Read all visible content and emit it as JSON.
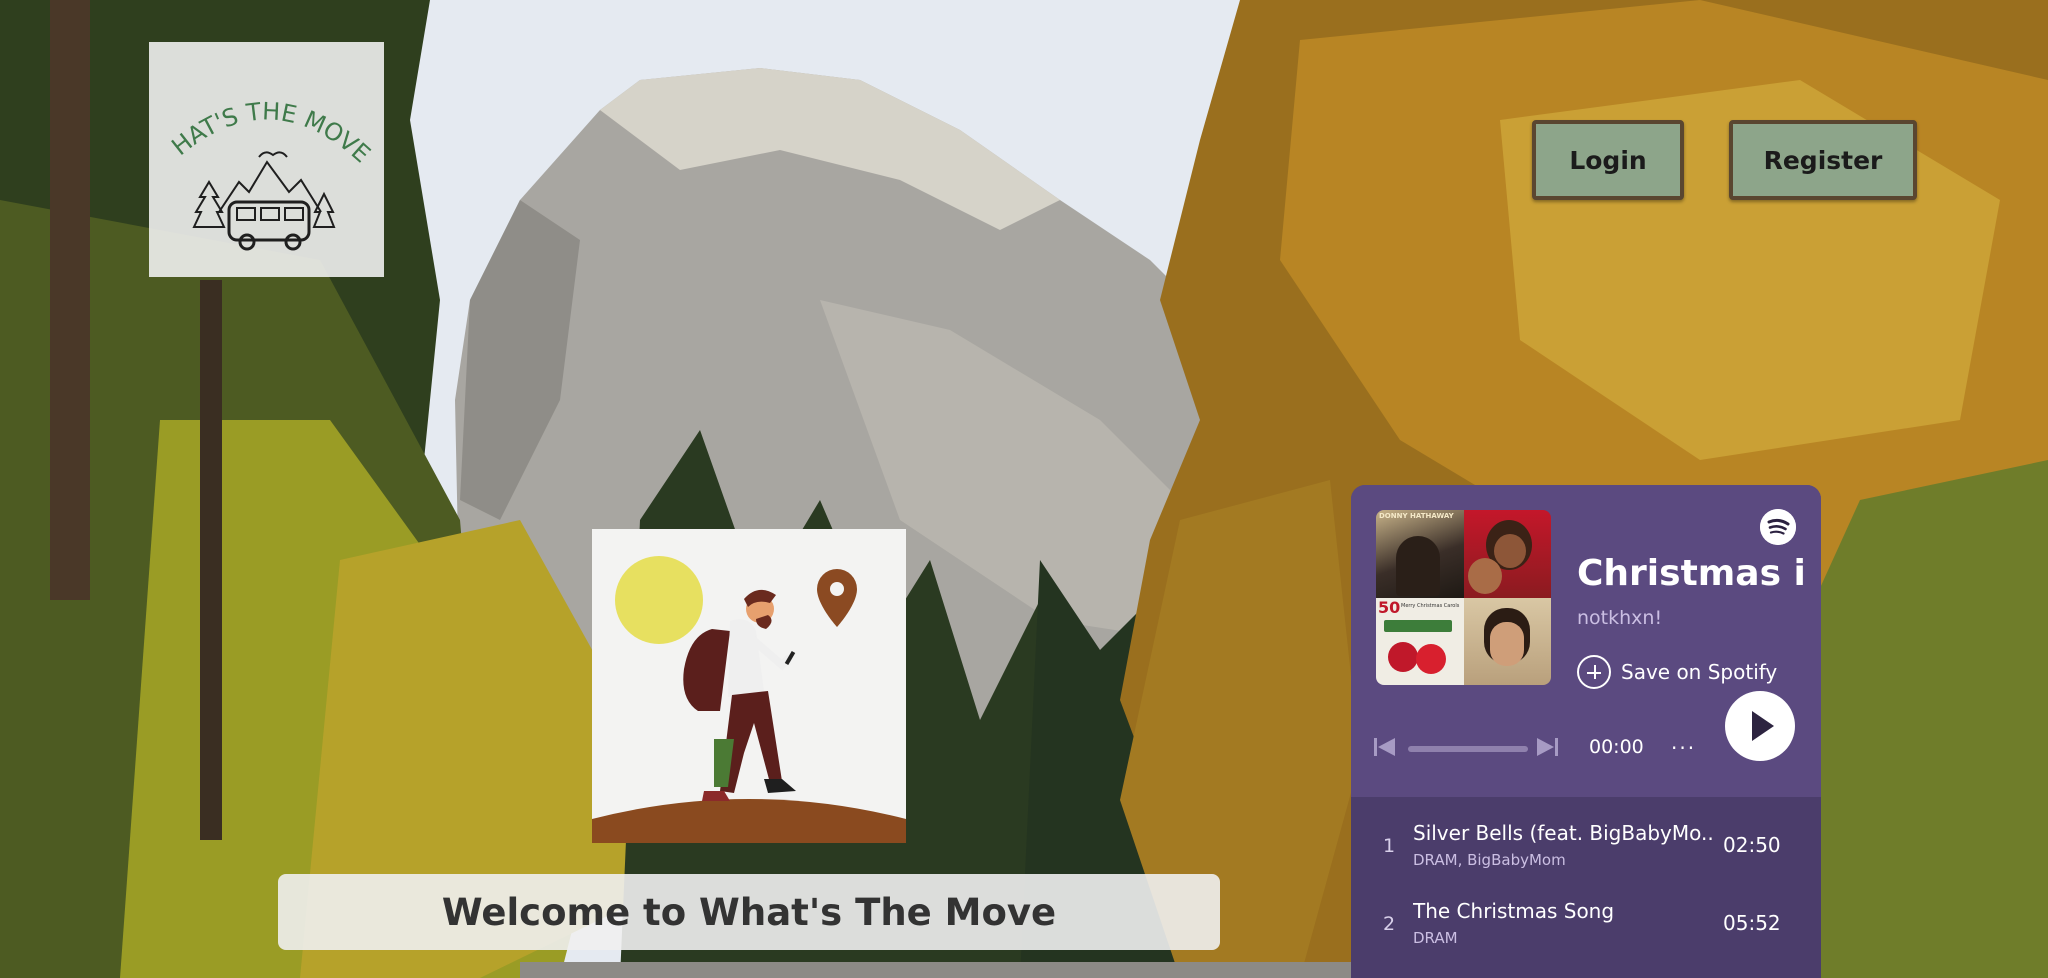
{
  "app": {
    "logo_text": "WHAT'S THE MOVE?"
  },
  "header": {
    "login_label": "Login",
    "register_label": "Register"
  },
  "hero": {
    "welcome": "Welcome to What's The Move"
  },
  "spotify": {
    "playlist_title": "Christmas ig",
    "owner": "notkhxn!",
    "save_label": "Save on Spotify",
    "time": "00:00",
    "more": "···",
    "progress_fraction": 0,
    "cover_texts": [
      "DONNY HATHAWAY",
      "50",
      "Merry Christmas Carols"
    ],
    "tracks": [
      {
        "index": "1",
        "title": "Silver Bells (feat. BigBabyMo...",
        "artist": "DRAM, BigBabyMom",
        "duration": "02:50"
      },
      {
        "index": "2",
        "title": "The Christmas Song",
        "artist": "DRAM",
        "duration": "05:52"
      }
    ]
  },
  "colors": {
    "button_bg": "#8da58a",
    "button_border": "#5a4630",
    "widget_bg": "#5b4a80",
    "widget_list_bg": "#4b3d6b",
    "sun": "#e7e060",
    "pin": "#8b4a22"
  },
  "icons": [
    "spotify-icon",
    "plus-circle-icon",
    "skip-previous-icon",
    "skip-next-icon",
    "play-icon",
    "more-icon",
    "location-pin-icon",
    "sun-icon"
  ]
}
